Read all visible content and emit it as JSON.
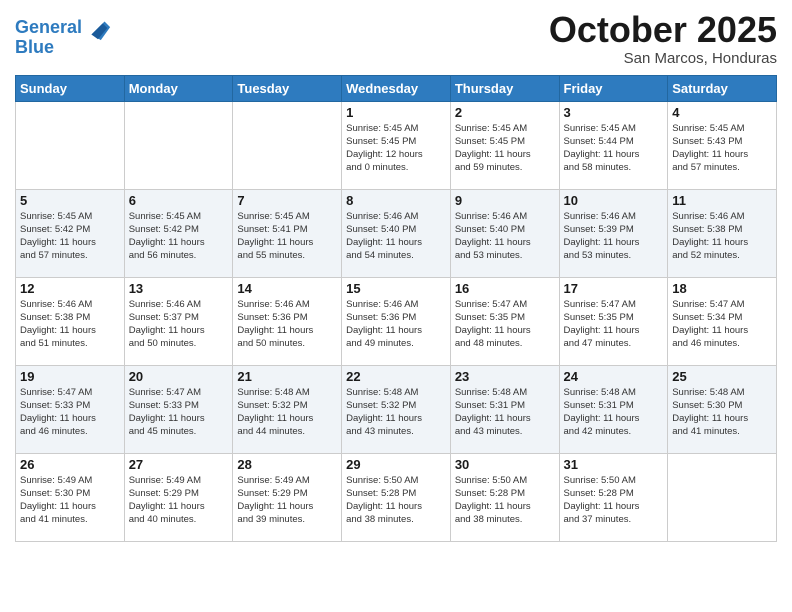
{
  "header": {
    "logo_line1": "General",
    "logo_line2": "Blue",
    "month": "October 2025",
    "location": "San Marcos, Honduras"
  },
  "weekdays": [
    "Sunday",
    "Monday",
    "Tuesday",
    "Wednesday",
    "Thursday",
    "Friday",
    "Saturday"
  ],
  "weeks": [
    [
      {
        "day": "",
        "info": ""
      },
      {
        "day": "",
        "info": ""
      },
      {
        "day": "",
        "info": ""
      },
      {
        "day": "1",
        "info": "Sunrise: 5:45 AM\nSunset: 5:45 PM\nDaylight: 12 hours\nand 0 minutes."
      },
      {
        "day": "2",
        "info": "Sunrise: 5:45 AM\nSunset: 5:45 PM\nDaylight: 11 hours\nand 59 minutes."
      },
      {
        "day": "3",
        "info": "Sunrise: 5:45 AM\nSunset: 5:44 PM\nDaylight: 11 hours\nand 58 minutes."
      },
      {
        "day": "4",
        "info": "Sunrise: 5:45 AM\nSunset: 5:43 PM\nDaylight: 11 hours\nand 57 minutes."
      }
    ],
    [
      {
        "day": "5",
        "info": "Sunrise: 5:45 AM\nSunset: 5:42 PM\nDaylight: 11 hours\nand 57 minutes."
      },
      {
        "day": "6",
        "info": "Sunrise: 5:45 AM\nSunset: 5:42 PM\nDaylight: 11 hours\nand 56 minutes."
      },
      {
        "day": "7",
        "info": "Sunrise: 5:45 AM\nSunset: 5:41 PM\nDaylight: 11 hours\nand 55 minutes."
      },
      {
        "day": "8",
        "info": "Sunrise: 5:46 AM\nSunset: 5:40 PM\nDaylight: 11 hours\nand 54 minutes."
      },
      {
        "day": "9",
        "info": "Sunrise: 5:46 AM\nSunset: 5:40 PM\nDaylight: 11 hours\nand 53 minutes."
      },
      {
        "day": "10",
        "info": "Sunrise: 5:46 AM\nSunset: 5:39 PM\nDaylight: 11 hours\nand 53 minutes."
      },
      {
        "day": "11",
        "info": "Sunrise: 5:46 AM\nSunset: 5:38 PM\nDaylight: 11 hours\nand 52 minutes."
      }
    ],
    [
      {
        "day": "12",
        "info": "Sunrise: 5:46 AM\nSunset: 5:38 PM\nDaylight: 11 hours\nand 51 minutes."
      },
      {
        "day": "13",
        "info": "Sunrise: 5:46 AM\nSunset: 5:37 PM\nDaylight: 11 hours\nand 50 minutes."
      },
      {
        "day": "14",
        "info": "Sunrise: 5:46 AM\nSunset: 5:36 PM\nDaylight: 11 hours\nand 50 minutes."
      },
      {
        "day": "15",
        "info": "Sunrise: 5:46 AM\nSunset: 5:36 PM\nDaylight: 11 hours\nand 49 minutes."
      },
      {
        "day": "16",
        "info": "Sunrise: 5:47 AM\nSunset: 5:35 PM\nDaylight: 11 hours\nand 48 minutes."
      },
      {
        "day": "17",
        "info": "Sunrise: 5:47 AM\nSunset: 5:35 PM\nDaylight: 11 hours\nand 47 minutes."
      },
      {
        "day": "18",
        "info": "Sunrise: 5:47 AM\nSunset: 5:34 PM\nDaylight: 11 hours\nand 46 minutes."
      }
    ],
    [
      {
        "day": "19",
        "info": "Sunrise: 5:47 AM\nSunset: 5:33 PM\nDaylight: 11 hours\nand 46 minutes."
      },
      {
        "day": "20",
        "info": "Sunrise: 5:47 AM\nSunset: 5:33 PM\nDaylight: 11 hours\nand 45 minutes."
      },
      {
        "day": "21",
        "info": "Sunrise: 5:48 AM\nSunset: 5:32 PM\nDaylight: 11 hours\nand 44 minutes."
      },
      {
        "day": "22",
        "info": "Sunrise: 5:48 AM\nSunset: 5:32 PM\nDaylight: 11 hours\nand 43 minutes."
      },
      {
        "day": "23",
        "info": "Sunrise: 5:48 AM\nSunset: 5:31 PM\nDaylight: 11 hours\nand 43 minutes."
      },
      {
        "day": "24",
        "info": "Sunrise: 5:48 AM\nSunset: 5:31 PM\nDaylight: 11 hours\nand 42 minutes."
      },
      {
        "day": "25",
        "info": "Sunrise: 5:48 AM\nSunset: 5:30 PM\nDaylight: 11 hours\nand 41 minutes."
      }
    ],
    [
      {
        "day": "26",
        "info": "Sunrise: 5:49 AM\nSunset: 5:30 PM\nDaylight: 11 hours\nand 41 minutes."
      },
      {
        "day": "27",
        "info": "Sunrise: 5:49 AM\nSunset: 5:29 PM\nDaylight: 11 hours\nand 40 minutes."
      },
      {
        "day": "28",
        "info": "Sunrise: 5:49 AM\nSunset: 5:29 PM\nDaylight: 11 hours\nand 39 minutes."
      },
      {
        "day": "29",
        "info": "Sunrise: 5:50 AM\nSunset: 5:28 PM\nDaylight: 11 hours\nand 38 minutes."
      },
      {
        "day": "30",
        "info": "Sunrise: 5:50 AM\nSunset: 5:28 PM\nDaylight: 11 hours\nand 38 minutes."
      },
      {
        "day": "31",
        "info": "Sunrise: 5:50 AM\nSunset: 5:28 PM\nDaylight: 11 hours\nand 37 minutes."
      },
      {
        "day": "",
        "info": ""
      }
    ]
  ]
}
